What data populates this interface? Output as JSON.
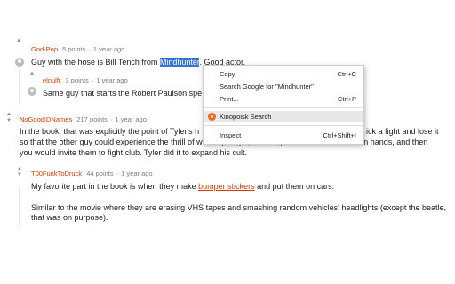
{
  "comments": [
    {
      "user": "God-Pop",
      "points": "5 points",
      "time": "1 year ago",
      "text_before": "Guy with the hose is Bill Tench from ",
      "highlighted": "Mindhunter",
      "text_after": ". Good actor."
    },
    {
      "user": "elnulfr",
      "points": "3 points",
      "time": "1 year ago",
      "text": "Same guy that starts the Robert Paulson spe"
    },
    {
      "user": "NoGoodIDNames",
      "points": "217 points",
      "time": "1 year ago",
      "line1_a": "In the book, that was explicitly the point of Tyler's h",
      "line1_b": "ick a fight and lose it",
      "line2": "so that the other guy could experience the thrill of winning a fight, of taking their lives into their own hands, and then",
      "line3": "you would invite them to fight club. Tyler did it to expand his cult."
    },
    {
      "user": "T00FunkToDruck",
      "points": "44 points",
      "time": "1 year ago",
      "text_before": "My favorite part in the book is when they make ",
      "link": "bumper stickers",
      "text_after": " and put them on cars.",
      "para2": "Similar to the movie where they are erasing VHS tapes and smashing random vehicles' headlights (except the beatle, that was on purpose)."
    }
  ],
  "vote_icons": {
    "up": "▲",
    "down": "▼"
  },
  "context_menu": {
    "items": [
      {
        "label": "Copy",
        "shortcut": "Ctrl+C"
      },
      {
        "label": "Search Google for \"Mindhunter\"",
        "shortcut": ""
      },
      {
        "label": "Print...",
        "shortcut": "Ctrl+P"
      },
      {
        "label": "Kinopoisk Search",
        "shortcut": "",
        "icon": "kinopoisk-icon"
      },
      {
        "label": "Inspect",
        "shortcut": "Ctrl+Shift+I"
      }
    ]
  },
  "colors": {
    "username": "#d93a00",
    "selection": "#3574d6",
    "kinopoisk": "#f26b1d"
  }
}
